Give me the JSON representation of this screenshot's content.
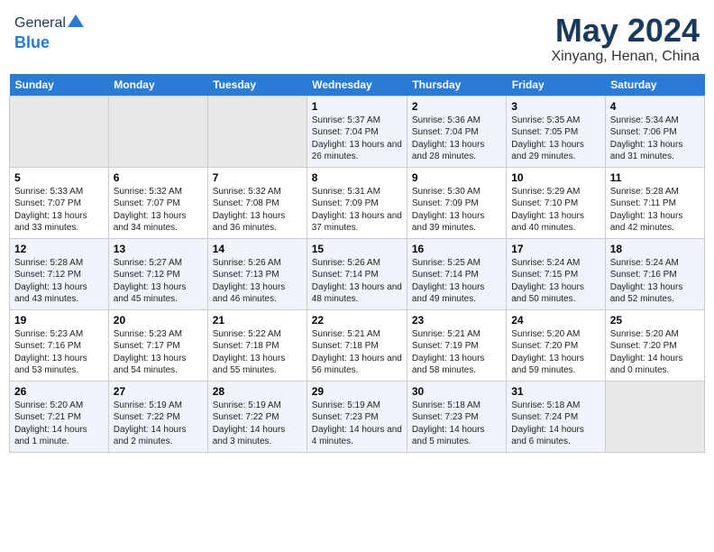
{
  "header": {
    "logo_general": "General",
    "logo_blue": "Blue",
    "month_title": "May 2024",
    "location": "Xinyang, Henan, China"
  },
  "weekdays": [
    "Sunday",
    "Monday",
    "Tuesday",
    "Wednesday",
    "Thursday",
    "Friday",
    "Saturday"
  ],
  "weeks": [
    [
      {
        "day": "",
        "sunrise": "",
        "sunset": "",
        "daylight": ""
      },
      {
        "day": "",
        "sunrise": "",
        "sunset": "",
        "daylight": ""
      },
      {
        "day": "",
        "sunrise": "",
        "sunset": "",
        "daylight": ""
      },
      {
        "day": "1",
        "sunrise": "Sunrise: 5:37 AM",
        "sunset": "Sunset: 7:04 PM",
        "daylight": "Daylight: 13 hours and 26 minutes."
      },
      {
        "day": "2",
        "sunrise": "Sunrise: 5:36 AM",
        "sunset": "Sunset: 7:04 PM",
        "daylight": "Daylight: 13 hours and 28 minutes."
      },
      {
        "day": "3",
        "sunrise": "Sunrise: 5:35 AM",
        "sunset": "Sunset: 7:05 PM",
        "daylight": "Daylight: 13 hours and 29 minutes."
      },
      {
        "day": "4",
        "sunrise": "Sunrise: 5:34 AM",
        "sunset": "Sunset: 7:06 PM",
        "daylight": "Daylight: 13 hours and 31 minutes."
      }
    ],
    [
      {
        "day": "5",
        "sunrise": "Sunrise: 5:33 AM",
        "sunset": "Sunset: 7:07 PM",
        "daylight": "Daylight: 13 hours and 33 minutes."
      },
      {
        "day": "6",
        "sunrise": "Sunrise: 5:32 AM",
        "sunset": "Sunset: 7:07 PM",
        "daylight": "Daylight: 13 hours and 34 minutes."
      },
      {
        "day": "7",
        "sunrise": "Sunrise: 5:32 AM",
        "sunset": "Sunset: 7:08 PM",
        "daylight": "Daylight: 13 hours and 36 minutes."
      },
      {
        "day": "8",
        "sunrise": "Sunrise: 5:31 AM",
        "sunset": "Sunset: 7:09 PM",
        "daylight": "Daylight: 13 hours and 37 minutes."
      },
      {
        "day": "9",
        "sunrise": "Sunrise: 5:30 AM",
        "sunset": "Sunset: 7:09 PM",
        "daylight": "Daylight: 13 hours and 39 minutes."
      },
      {
        "day": "10",
        "sunrise": "Sunrise: 5:29 AM",
        "sunset": "Sunset: 7:10 PM",
        "daylight": "Daylight: 13 hours and 40 minutes."
      },
      {
        "day": "11",
        "sunrise": "Sunrise: 5:28 AM",
        "sunset": "Sunset: 7:11 PM",
        "daylight": "Daylight: 13 hours and 42 minutes."
      }
    ],
    [
      {
        "day": "12",
        "sunrise": "Sunrise: 5:28 AM",
        "sunset": "Sunset: 7:12 PM",
        "daylight": "Daylight: 13 hours and 43 minutes."
      },
      {
        "day": "13",
        "sunrise": "Sunrise: 5:27 AM",
        "sunset": "Sunset: 7:12 PM",
        "daylight": "Daylight: 13 hours and 45 minutes."
      },
      {
        "day": "14",
        "sunrise": "Sunrise: 5:26 AM",
        "sunset": "Sunset: 7:13 PM",
        "daylight": "Daylight: 13 hours and 46 minutes."
      },
      {
        "day": "15",
        "sunrise": "Sunrise: 5:26 AM",
        "sunset": "Sunset: 7:14 PM",
        "daylight": "Daylight: 13 hours and 48 minutes."
      },
      {
        "day": "16",
        "sunrise": "Sunrise: 5:25 AM",
        "sunset": "Sunset: 7:14 PM",
        "daylight": "Daylight: 13 hours and 49 minutes."
      },
      {
        "day": "17",
        "sunrise": "Sunrise: 5:24 AM",
        "sunset": "Sunset: 7:15 PM",
        "daylight": "Daylight: 13 hours and 50 minutes."
      },
      {
        "day": "18",
        "sunrise": "Sunrise: 5:24 AM",
        "sunset": "Sunset: 7:16 PM",
        "daylight": "Daylight: 13 hours and 52 minutes."
      }
    ],
    [
      {
        "day": "19",
        "sunrise": "Sunrise: 5:23 AM",
        "sunset": "Sunset: 7:16 PM",
        "daylight": "Daylight: 13 hours and 53 minutes."
      },
      {
        "day": "20",
        "sunrise": "Sunrise: 5:23 AM",
        "sunset": "Sunset: 7:17 PM",
        "daylight": "Daylight: 13 hours and 54 minutes."
      },
      {
        "day": "21",
        "sunrise": "Sunrise: 5:22 AM",
        "sunset": "Sunset: 7:18 PM",
        "daylight": "Daylight: 13 hours and 55 minutes."
      },
      {
        "day": "22",
        "sunrise": "Sunrise: 5:21 AM",
        "sunset": "Sunset: 7:18 PM",
        "daylight": "Daylight: 13 hours and 56 minutes."
      },
      {
        "day": "23",
        "sunrise": "Sunrise: 5:21 AM",
        "sunset": "Sunset: 7:19 PM",
        "daylight": "Daylight: 13 hours and 58 minutes."
      },
      {
        "day": "24",
        "sunrise": "Sunrise: 5:20 AM",
        "sunset": "Sunset: 7:20 PM",
        "daylight": "Daylight: 13 hours and 59 minutes."
      },
      {
        "day": "25",
        "sunrise": "Sunrise: 5:20 AM",
        "sunset": "Sunset: 7:20 PM",
        "daylight": "Daylight: 14 hours and 0 minutes."
      }
    ],
    [
      {
        "day": "26",
        "sunrise": "Sunrise: 5:20 AM",
        "sunset": "Sunset: 7:21 PM",
        "daylight": "Daylight: 14 hours and 1 minute."
      },
      {
        "day": "27",
        "sunrise": "Sunrise: 5:19 AM",
        "sunset": "Sunset: 7:22 PM",
        "daylight": "Daylight: 14 hours and 2 minutes."
      },
      {
        "day": "28",
        "sunrise": "Sunrise: 5:19 AM",
        "sunset": "Sunset: 7:22 PM",
        "daylight": "Daylight: 14 hours and 3 minutes."
      },
      {
        "day": "29",
        "sunrise": "Sunrise: 5:19 AM",
        "sunset": "Sunset: 7:23 PM",
        "daylight": "Daylight: 14 hours and 4 minutes."
      },
      {
        "day": "30",
        "sunrise": "Sunrise: 5:18 AM",
        "sunset": "Sunset: 7:23 PM",
        "daylight": "Daylight: 14 hours and 5 minutes."
      },
      {
        "day": "31",
        "sunrise": "Sunrise: 5:18 AM",
        "sunset": "Sunset: 7:24 PM",
        "daylight": "Daylight: 14 hours and 6 minutes."
      },
      {
        "day": "",
        "sunrise": "",
        "sunset": "",
        "daylight": ""
      }
    ]
  ]
}
